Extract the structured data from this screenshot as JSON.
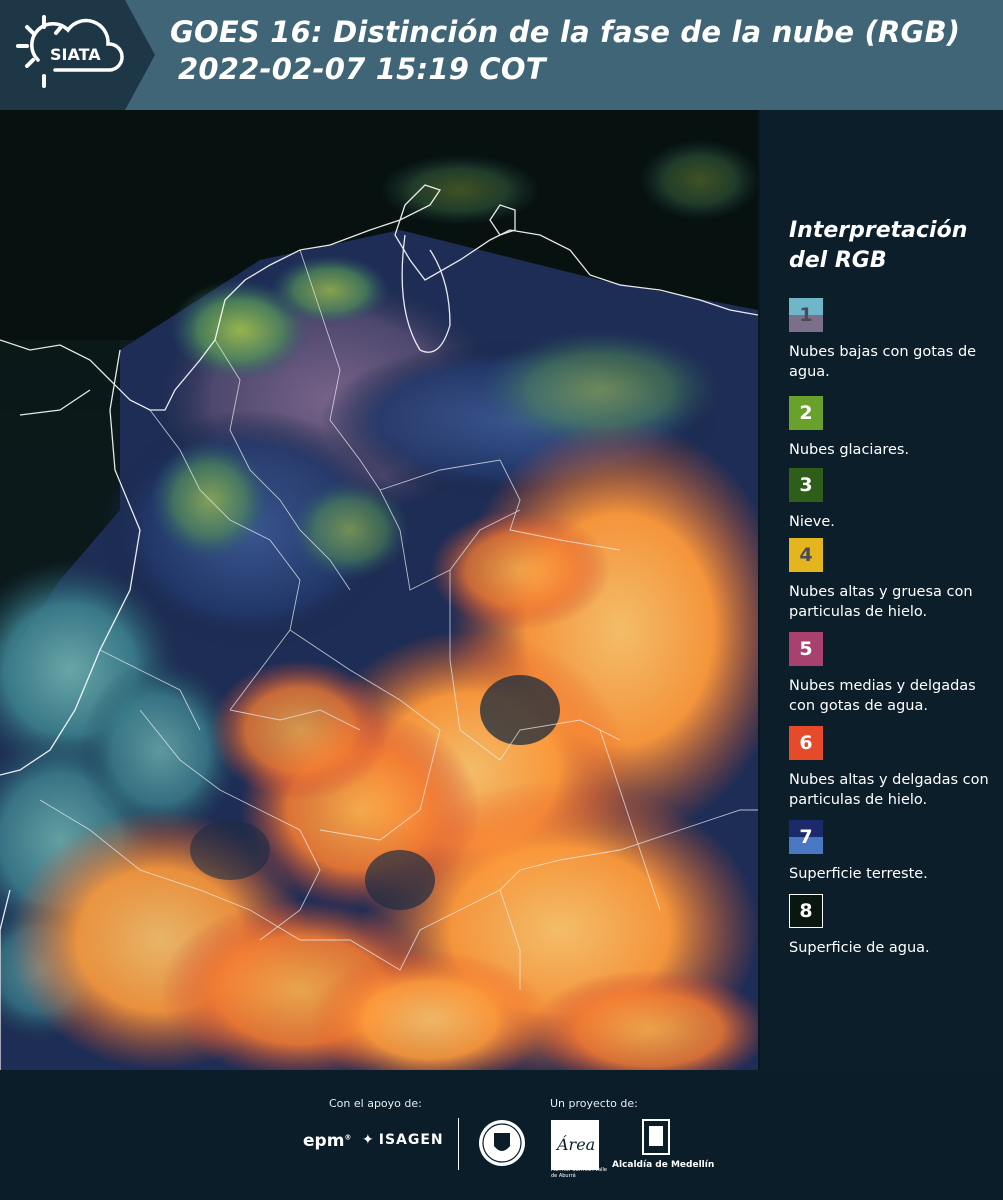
{
  "header": {
    "logo_text": "SIATA",
    "title_line1": "GOES 16: Distinción de la fase de la nube (RGB)",
    "title_line2": "2022-02-07 15:19 COT"
  },
  "legend": {
    "title_line1": "Interpretación",
    "title_line2": "del RGB",
    "items": [
      {
        "num": "1",
        "label": "Nubes bajas con gotas de agua.",
        "color_top": "#6fb7c8",
        "color_bottom": "#7b6f8b",
        "num_color": "#4b4b55"
      },
      {
        "num": "2",
        "label": "Nubes glaciares.",
        "color": "#6aa12d",
        "num_color": "#ffffff"
      },
      {
        "num": "3",
        "label": "Nieve.",
        "color": "#2f5d1a",
        "num_color": "#ffffff"
      },
      {
        "num": "4",
        "label": "Nubes altas y gruesa con particulas de hielo.",
        "color": "#e5b520",
        "num_color": "#4b4b55"
      },
      {
        "num": "5",
        "label": "Nubes medias y delgadas con gotas de agua.",
        "color": "#a9416f",
        "num_color": "#ffffff"
      },
      {
        "num": "6",
        "label": "Nubes altas y delgadas con particulas de hielo.",
        "color": "#e54a2a",
        "num_color": "#ffffff"
      },
      {
        "num": "7",
        "label": "Superficie terreste.",
        "color_top": "#1c2a6b",
        "color_bottom": "#4a77c4",
        "num_color": "#ffffff"
      },
      {
        "num": "8",
        "label": "Superficie de agua.",
        "color": "#0a1610",
        "border": "#ffffff",
        "num_color": "#ffffff"
      }
    ]
  },
  "footer": {
    "support_label": "Con el apoyo de:",
    "project_label": "Un proyecto de:",
    "epm": "epm",
    "isagen": "ISAGEN",
    "amva_text": "METROPOLITANA Valle de Aburrá",
    "amva_mark": "Área",
    "alcaldia": "Alcaldía de Medellín"
  },
  "colors": {
    "header_bg": "#3f6577",
    "logo_bg": "#1e3747",
    "panel_bg": "#0c1e2a"
  }
}
